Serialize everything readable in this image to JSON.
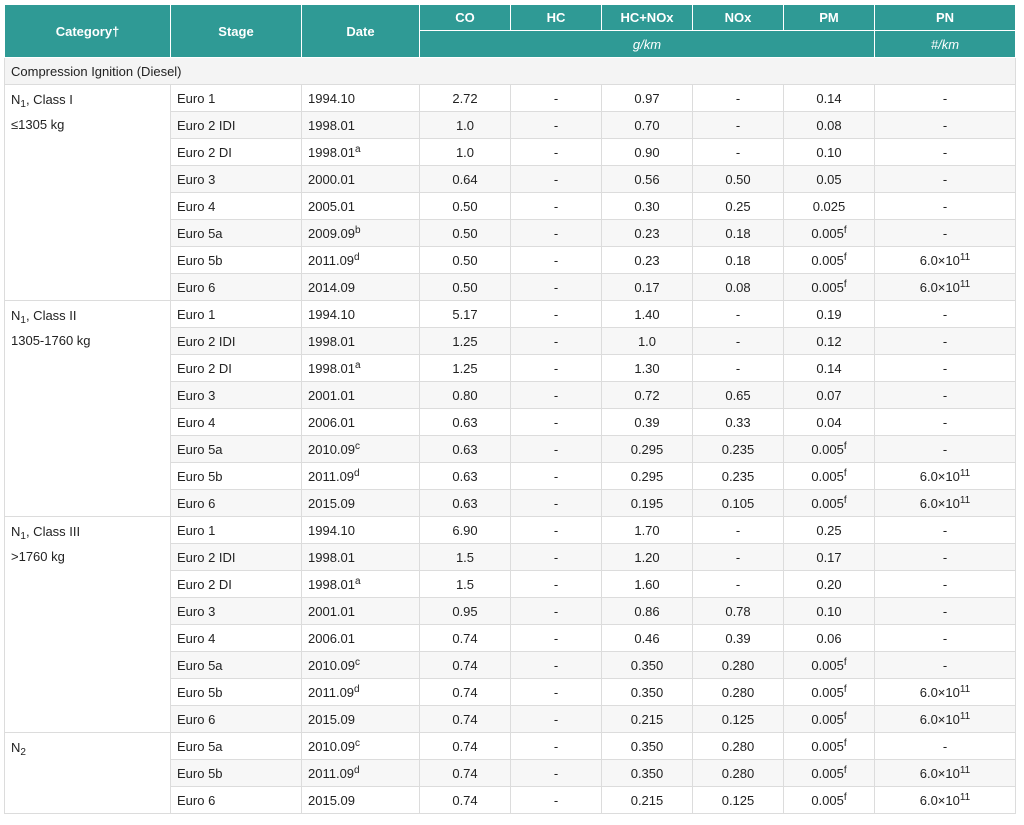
{
  "header": {
    "category": "Category",
    "dagger": "†",
    "stage": "Stage",
    "date": "Date",
    "co": "CO",
    "hc": "HC",
    "hcnox": "HC+NOx",
    "nox": "NOx",
    "pm": "PM",
    "pn": "PN",
    "unit_gkm": "g/km",
    "unit_pn": "#/km"
  },
  "section": {
    "title": "Compression Ignition (Diesel)"
  },
  "groups": [
    {
      "cat_prefix": "N",
      "cat_sub": "1",
      "cat_suffix": ", Class I",
      "cat_line2": "≤1305 kg",
      "rows": [
        {
          "stage": "Euro 1",
          "date": "1994.10",
          "date_sup": "",
          "co": "2.72",
          "hc": "-",
          "hcnox": "0.97",
          "nox": "-",
          "pm": "0.14",
          "pm_sup": "",
          "pn_base": "-",
          "pn_exp": ""
        },
        {
          "stage": "Euro 2 IDI",
          "date": "1998.01",
          "date_sup": "",
          "co": "1.0",
          "hc": "-",
          "hcnox": "0.70",
          "nox": "-",
          "pm": "0.08",
          "pm_sup": "",
          "pn_base": "-",
          "pn_exp": ""
        },
        {
          "stage": "Euro 2 DI",
          "date": "1998.01",
          "date_sup": "a",
          "co": "1.0",
          "hc": "-",
          "hcnox": "0.90",
          "nox": "-",
          "pm": "0.10",
          "pm_sup": "",
          "pn_base": "-",
          "pn_exp": ""
        },
        {
          "stage": "Euro 3",
          "date": "2000.01",
          "date_sup": "",
          "co": "0.64",
          "hc": "-",
          "hcnox": "0.56",
          "nox": "0.50",
          "pm": "0.05",
          "pm_sup": "",
          "pn_base": "-",
          "pn_exp": ""
        },
        {
          "stage": "Euro 4",
          "date": "2005.01",
          "date_sup": "",
          "co": "0.50",
          "hc": "-",
          "hcnox": "0.30",
          "nox": "0.25",
          "pm": "0.025",
          "pm_sup": "",
          "pn_base": "-",
          "pn_exp": ""
        },
        {
          "stage": "Euro 5a",
          "date": "2009.09",
          "date_sup": "b",
          "co": "0.50",
          "hc": "-",
          "hcnox": "0.23",
          "nox": "0.18",
          "pm": "0.005",
          "pm_sup": "f",
          "pn_base": "-",
          "pn_exp": ""
        },
        {
          "stage": "Euro 5b",
          "date": "2011.09",
          "date_sup": "d",
          "co": "0.50",
          "hc": "-",
          "hcnox": "0.23",
          "nox": "0.18",
          "pm": "0.005",
          "pm_sup": "f",
          "pn_base": "6.0×10",
          "pn_exp": "11"
        },
        {
          "stage": "Euro 6",
          "date": "2014.09",
          "date_sup": "",
          "co": "0.50",
          "hc": "-",
          "hcnox": "0.17",
          "nox": "0.08",
          "pm": "0.005",
          "pm_sup": "f",
          "pn_base": "6.0×10",
          "pn_exp": "11"
        }
      ]
    },
    {
      "cat_prefix": "N",
      "cat_sub": "1",
      "cat_suffix": ", Class II",
      "cat_line2": "1305-1760 kg",
      "rows": [
        {
          "stage": "Euro 1",
          "date": "1994.10",
          "date_sup": "",
          "co": "5.17",
          "hc": "-",
          "hcnox": "1.40",
          "nox": "-",
          "pm": "0.19",
          "pm_sup": "",
          "pn_base": "-",
          "pn_exp": ""
        },
        {
          "stage": "Euro 2 IDI",
          "date": "1998.01",
          "date_sup": "",
          "co": "1.25",
          "hc": "-",
          "hcnox": "1.0",
          "nox": "-",
          "pm": "0.12",
          "pm_sup": "",
          "pn_base": "-",
          "pn_exp": ""
        },
        {
          "stage": "Euro 2 DI",
          "date": "1998.01",
          "date_sup": "a",
          "co": "1.25",
          "hc": "-",
          "hcnox": "1.30",
          "nox": "-",
          "pm": "0.14",
          "pm_sup": "",
          "pn_base": "-",
          "pn_exp": ""
        },
        {
          "stage": "Euro 3",
          "date": "2001.01",
          "date_sup": "",
          "co": "0.80",
          "hc": "-",
          "hcnox": "0.72",
          "nox": "0.65",
          "pm": "0.07",
          "pm_sup": "",
          "pn_base": "-",
          "pn_exp": ""
        },
        {
          "stage": "Euro 4",
          "date": "2006.01",
          "date_sup": "",
          "co": "0.63",
          "hc": "-",
          "hcnox": "0.39",
          "nox": "0.33",
          "pm": "0.04",
          "pm_sup": "",
          "pn_base": "-",
          "pn_exp": ""
        },
        {
          "stage": "Euro 5a",
          "date": "2010.09",
          "date_sup": "c",
          "co": "0.63",
          "hc": "-",
          "hcnox": "0.295",
          "nox": "0.235",
          "pm": "0.005",
          "pm_sup": "f",
          "pn_base": "-",
          "pn_exp": ""
        },
        {
          "stage": "Euro 5b",
          "date": "2011.09",
          "date_sup": "d",
          "co": "0.63",
          "hc": "-",
          "hcnox": "0.295",
          "nox": "0.235",
          "pm": "0.005",
          "pm_sup": "f",
          "pn_base": "6.0×10",
          "pn_exp": "11"
        },
        {
          "stage": "Euro 6",
          "date": "2015.09",
          "date_sup": "",
          "co": "0.63",
          "hc": "-",
          "hcnox": "0.195",
          "nox": "0.105",
          "pm": "0.005",
          "pm_sup": "f",
          "pn_base": "6.0×10",
          "pn_exp": "11"
        }
      ]
    },
    {
      "cat_prefix": "N",
      "cat_sub": "1",
      "cat_suffix": ", Class III",
      "cat_line2": ">1760 kg",
      "rows": [
        {
          "stage": "Euro 1",
          "date": "1994.10",
          "date_sup": "",
          "co": "6.90",
          "hc": "-",
          "hcnox": "1.70",
          "nox": "-",
          "pm": "0.25",
          "pm_sup": "",
          "pn_base": "-",
          "pn_exp": ""
        },
        {
          "stage": "Euro 2 IDI",
          "date": "1998.01",
          "date_sup": "",
          "co": "1.5",
          "hc": "-",
          "hcnox": "1.20",
          "nox": "-",
          "pm": "0.17",
          "pm_sup": "",
          "pn_base": "-",
          "pn_exp": ""
        },
        {
          "stage": "Euro 2 DI",
          "date": "1998.01",
          "date_sup": "a",
          "co": "1.5",
          "hc": "-",
          "hcnox": "1.60",
          "nox": "-",
          "pm": "0.20",
          "pm_sup": "",
          "pn_base": "-",
          "pn_exp": ""
        },
        {
          "stage": "Euro 3",
          "date": "2001.01",
          "date_sup": "",
          "co": "0.95",
          "hc": "-",
          "hcnox": "0.86",
          "nox": "0.78",
          "pm": "0.10",
          "pm_sup": "",
          "pn_base": "-",
          "pn_exp": ""
        },
        {
          "stage": "Euro 4",
          "date": "2006.01",
          "date_sup": "",
          "co": "0.74",
          "hc": "-",
          "hcnox": "0.46",
          "nox": "0.39",
          "pm": "0.06",
          "pm_sup": "",
          "pn_base": "-",
          "pn_exp": ""
        },
        {
          "stage": "Euro 5a",
          "date": "2010.09",
          "date_sup": "c",
          "co": "0.74",
          "hc": "-",
          "hcnox": "0.350",
          "nox": "0.280",
          "pm": "0.005",
          "pm_sup": "f",
          "pn_base": "-",
          "pn_exp": ""
        },
        {
          "stage": "Euro 5b",
          "date": "2011.09",
          "date_sup": "d",
          "co": "0.74",
          "hc": "-",
          "hcnox": "0.350",
          "nox": "0.280",
          "pm": "0.005",
          "pm_sup": "f",
          "pn_base": "6.0×10",
          "pn_exp": "11"
        },
        {
          "stage": "Euro 6",
          "date": "2015.09",
          "date_sup": "",
          "co": "0.74",
          "hc": "-",
          "hcnox": "0.215",
          "nox": "0.125",
          "pm": "0.005",
          "pm_sup": "f",
          "pn_base": "6.0×10",
          "pn_exp": "11"
        }
      ]
    },
    {
      "cat_prefix": "N",
      "cat_sub": "2",
      "cat_suffix": "",
      "cat_line2": "",
      "rows": [
        {
          "stage": "Euro 5a",
          "date": "2010.09",
          "date_sup": "c",
          "co": "0.74",
          "hc": "-",
          "hcnox": "0.350",
          "nox": "0.280",
          "pm": "0.005",
          "pm_sup": "f",
          "pn_base": "-",
          "pn_exp": ""
        },
        {
          "stage": "Euro 5b",
          "date": "2011.09",
          "date_sup": "d",
          "co": "0.74",
          "hc": "-",
          "hcnox": "0.350",
          "nox": "0.280",
          "pm": "0.005",
          "pm_sup": "f",
          "pn_base": "6.0×10",
          "pn_exp": "11"
        },
        {
          "stage": "Euro 6",
          "date": "2015.09",
          "date_sup": "",
          "co": "0.74",
          "hc": "-",
          "hcnox": "0.215",
          "nox": "0.125",
          "pm": "0.005",
          "pm_sup": "f",
          "pn_base": "6.0×10",
          "pn_exp": "11"
        }
      ]
    }
  ]
}
